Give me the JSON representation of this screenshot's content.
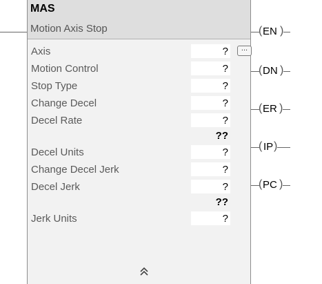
{
  "block": {
    "name": "MAS",
    "description": "Motion Axis Stop",
    "rows": [
      {
        "label": "Axis",
        "value": "?"
      },
      {
        "label": "Motion Control",
        "value": "?"
      },
      {
        "label": "Stop Type",
        "value": "?"
      },
      {
        "label": "Change Decel",
        "value": "?"
      },
      {
        "label": "Decel Rate",
        "value": "?"
      },
      {
        "label": "",
        "value": "??"
      },
      {
        "label": "Decel Units",
        "value": "?"
      },
      {
        "label": "Change Decel Jerk",
        "value": "?"
      },
      {
        "label": "Decel Jerk",
        "value": "?"
      },
      {
        "label": "",
        "value": "??"
      },
      {
        "label": "Jerk Units",
        "value": "?"
      }
    ],
    "browse_button_label": "...",
    "collapse_icon": "double-chevron-up-icon"
  },
  "outputs": [
    {
      "label": "EN"
    },
    {
      "label": "DN"
    },
    {
      "label": "ER"
    },
    {
      "label": "IP"
    },
    {
      "label": "PC"
    }
  ]
}
